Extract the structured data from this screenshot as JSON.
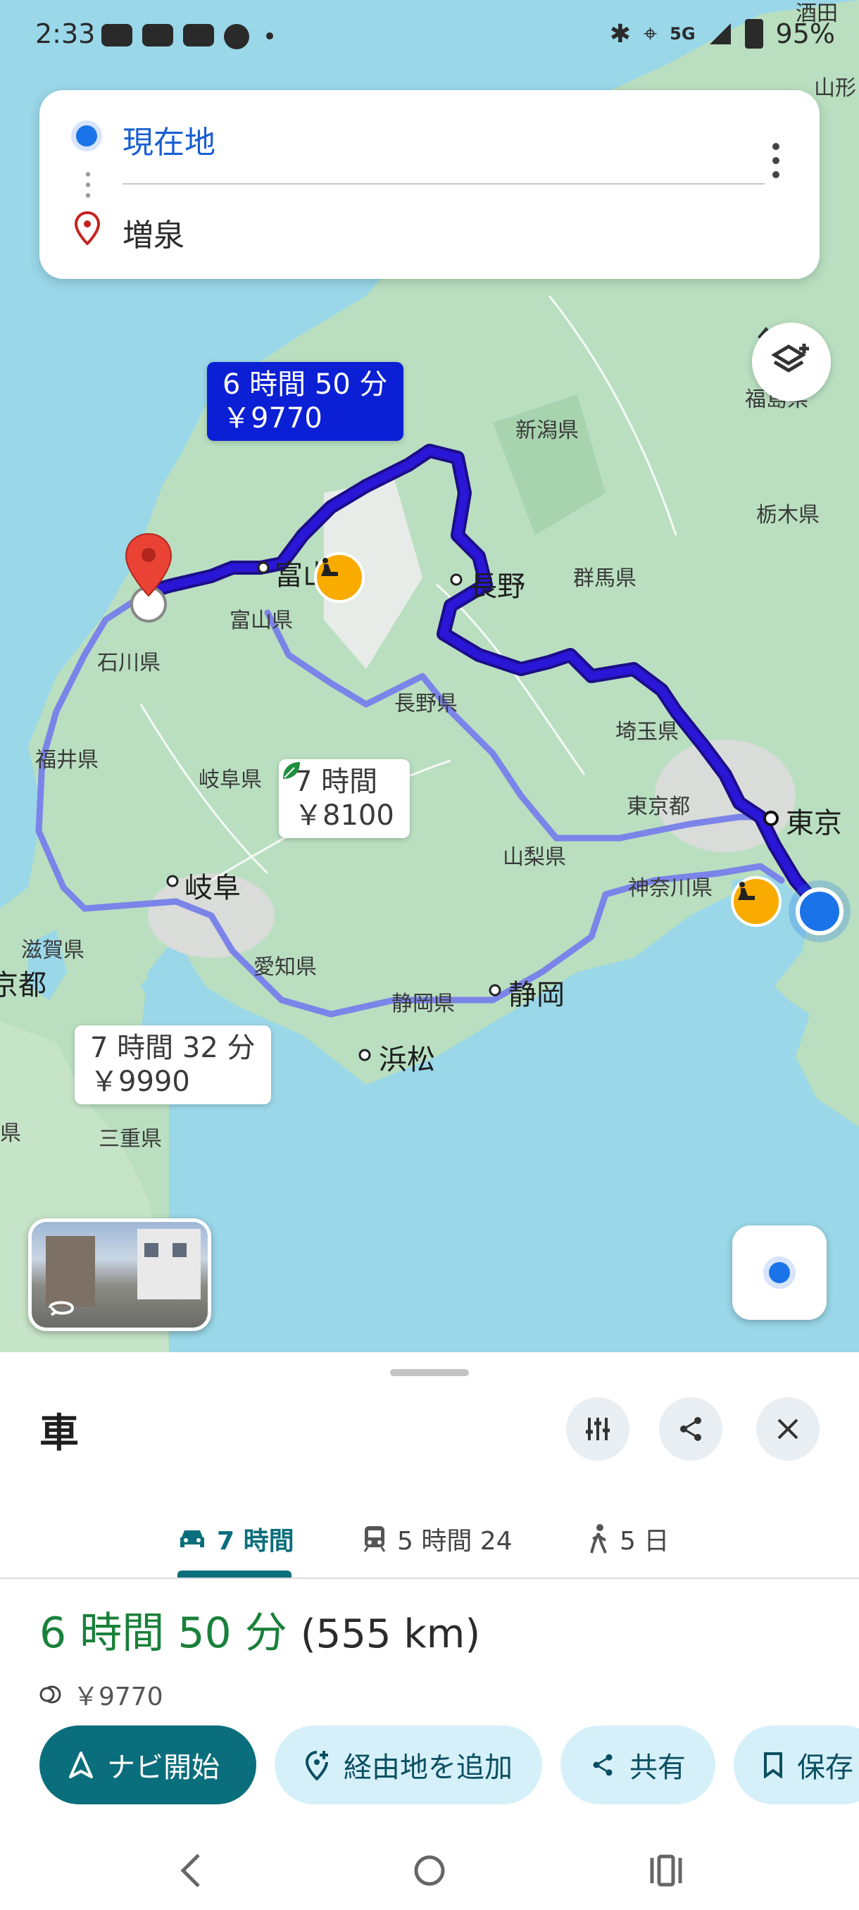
{
  "status_bar": {
    "time": "2:33",
    "network": "5G",
    "battery": "95%",
    "corner_place": "酒田"
  },
  "search": {
    "origin": "現在地",
    "destination": "増泉"
  },
  "callouts": {
    "selected": {
      "time": "6 時間 50 分",
      "cost": "￥9770"
    },
    "eco": {
      "time": "7 時間",
      "cost": "￥8100"
    },
    "alt": {
      "time": "7 時間 32 分",
      "cost": "￥9990"
    }
  },
  "map_labels": {
    "yamagata": "山形",
    "niigata_ken": "新潟県",
    "fukushima_ken": "福島県",
    "tochigi_ken": "栃木県",
    "toyama": "富山",
    "toyama_ken": "富山県",
    "nagano": "長野",
    "gunma_ken": "群馬県",
    "ishikawa_ken": "石川県",
    "nagano_ken": "長野県",
    "saitama_ken": "埼玉県",
    "fukui_ken": "福井県",
    "gifu_ken": "岐阜県",
    "tokyo_to": "東京都",
    "tokyo": "東京",
    "yamanashi_ken": "山梨県",
    "kanagawa_ken": "神奈川県",
    "gifu": "岐阜",
    "shiga_ken": "滋賀県",
    "kyoto": "京都",
    "aichi_ken": "愛知県",
    "shizuoka_ken": "静岡県",
    "shizuoka": "静岡",
    "hamamatsu": "浜松",
    "mie_ken": "三重県",
    "ken_partial": "県"
  },
  "sheet": {
    "mode_title": "車",
    "tabs": [
      {
        "label": "7 時間",
        "icon": "car-icon"
      },
      {
        "label": "5 時間 24",
        "icon": "train-icon"
      },
      {
        "label": "5 日",
        "icon": "walk-icon"
      }
    ],
    "summary_time": "6 時間 50 分",
    "summary_distance": "(555 km)",
    "toll": "￥9770",
    "actions": {
      "start": "ナビ開始",
      "add_stop": "経由地を追加",
      "share": "共有",
      "save": "保存"
    }
  },
  "colors": {
    "selected_route": "#2a16d6",
    "alt_route": "#7b84e8",
    "accent_teal": "#0b6e7c",
    "eta_green": "#19803a"
  }
}
